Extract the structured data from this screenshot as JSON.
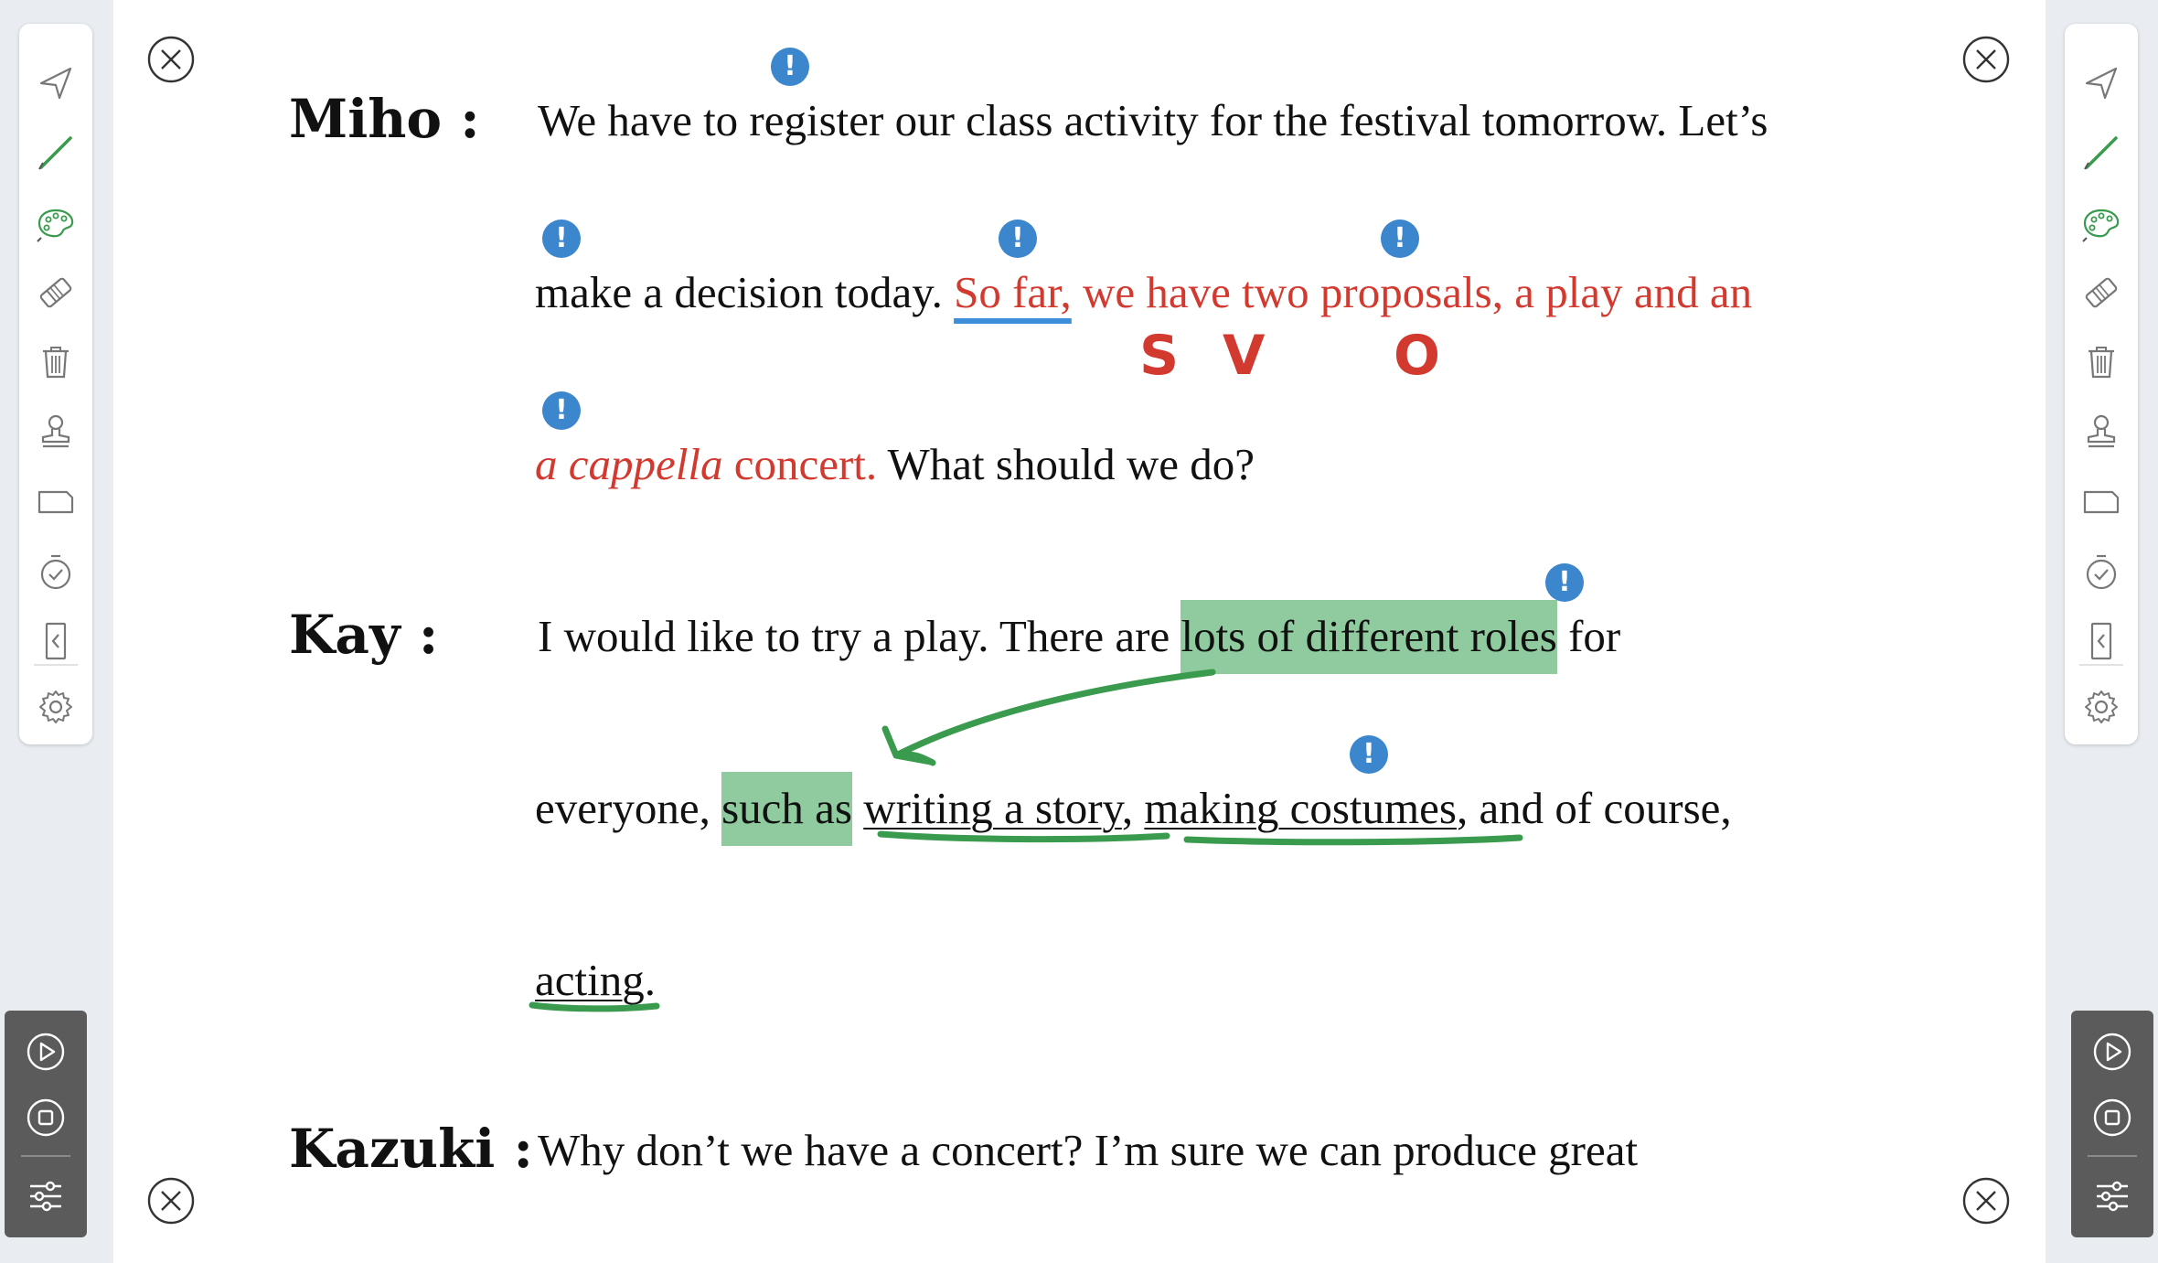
{
  "tools": [
    {
      "name": "pointer-icon"
    },
    {
      "name": "pen-icon"
    },
    {
      "name": "palette-icon"
    },
    {
      "name": "eraser-icon"
    },
    {
      "name": "trash-icon"
    },
    {
      "name": "stamp-icon"
    },
    {
      "name": "card-icon"
    },
    {
      "name": "timer-icon"
    },
    {
      "name": "collapse-icon"
    },
    {
      "name": "gear-icon"
    }
  ],
  "dialogue": {
    "miho": {
      "speaker": "Miho :",
      "l1": "We have to register our class activity for the festival tomorrow.  Let’s",
      "l2_a": "make a decision today.  ",
      "l2_b": "So far,",
      "l2_c": " we have two proposals, a play and an",
      "l3_a": "a cappella",
      "l3_b": " concert.",
      "l3_c": "  What should we do?"
    },
    "kay": {
      "speaker": "Kay :",
      "l1_a": "I would like to try a play.  There are ",
      "l1_b": "lots of different roles",
      "l1_c": " for",
      "l2_a": "everyone, ",
      "l2_b": "such as",
      "l2_c": " ",
      "l2_d": "writing a story",
      "l2_e": ", ",
      "l2_f": "making costumes",
      "l2_g": ", and of course,",
      "l3_a": "acting",
      "l3_b": "."
    },
    "kazuki": {
      "speaker": "Kazuki :",
      "l1": "Why don’t we have a concert?  I’m sure we can produce great"
    }
  },
  "annotations": {
    "pin_mark": "!",
    "subject": "S",
    "verb": "V",
    "object": "O"
  },
  "colors": {
    "ink_red": "#d23a2f",
    "ink_green": "#3a9a4e",
    "highlight_green": "#8fcb9e",
    "pin_blue": "#3b86cc",
    "panel_dark": "#5b5b5b"
  }
}
